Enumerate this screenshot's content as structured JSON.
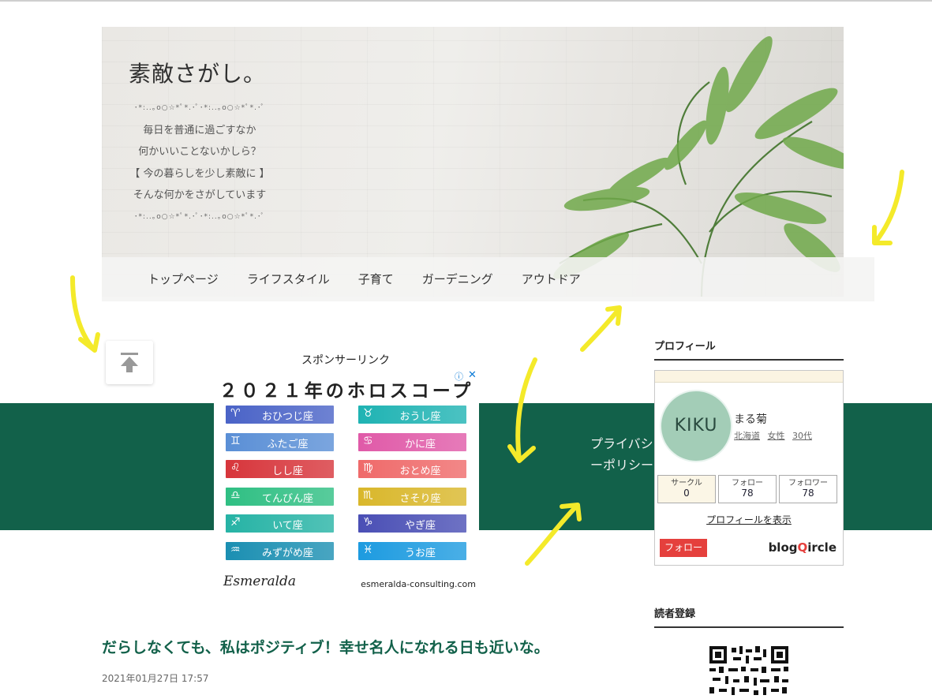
{
  "header": {
    "site_title": "素敵さがし。",
    "tagline_dots_top": "･*:..｡o○☆*ﾟ*.･ﾟ･*:..｡o○☆*ﾟ*.･ﾟ",
    "tagline_lines": [
      "毎日を普通に過ごすなか",
      "何かいいことないかしら？",
      "【 今の暮らしを少し素敵に 】",
      "そんな何かをさがしています"
    ],
    "tagline_dots_bottom": "･*:..｡o○☆*ﾟ*.･ﾟ･*:..｡o○☆*ﾟ*.･ﾟ"
  },
  "nav": {
    "items": [
      "トップページ",
      "ライフスタイル",
      "子育て",
      "ガーデニング",
      "アウトドア"
    ]
  },
  "sponsor": {
    "label": "スポンサーリンク",
    "ad_title": "２０２１年のホロスコープ",
    "info_icon": "info-icon",
    "close_icon": "close-icon",
    "signs_left": [
      {
        "symbol": "♈",
        "name": "おひつじ座",
        "color": "#4a63c7"
      },
      {
        "symbol": "♊",
        "name": "ふたご座",
        "color": "#5a8fd6"
      },
      {
        "symbol": "♌",
        "name": "しし座",
        "color": "#d7353b"
      },
      {
        "symbol": "♎",
        "name": "てんびん座",
        "color": "#2fbf83"
      },
      {
        "symbol": "♐",
        "name": "いて座",
        "color": "#26b3a5"
      },
      {
        "symbol": "♒",
        "name": "みずがめ座",
        "color": "#1b8fb2"
      }
    ],
    "signs_right": [
      {
        "symbol": "♉",
        "name": "おうし座",
        "color": "#1fb3b3"
      },
      {
        "symbol": "♋",
        "name": "かに座",
        "color": "#e05aa8"
      },
      {
        "symbol": "♍",
        "name": "おとめ座",
        "color": "#ef6a6a"
      },
      {
        "symbol": "♏",
        "name": "さそり座",
        "color": "#d9b72b"
      },
      {
        "symbol": "♑",
        "name": "やぎ座",
        "color": "#4a4fb5"
      },
      {
        "symbol": "♓",
        "name": "うお座",
        "color": "#1d9be0"
      }
    ],
    "brand": "Esmeralda",
    "url": "esmeralda-consulting.com"
  },
  "privacy_link": "プライバシーポリシー",
  "post": {
    "title": "だらしなくても、私はポジティブ！幸せ名人になれる日も近いな。",
    "date": "2021年01月27日 17:57"
  },
  "sidebar": {
    "profile_heading": "プロフィール",
    "avatar_text": "KIKU",
    "name": "まる菊",
    "meta": [
      "北海道",
      "女性",
      "30代"
    ],
    "stats": [
      {
        "label": "サークル",
        "value": "0"
      },
      {
        "label": "フォロー",
        "value": "78"
      },
      {
        "label": "フォロワー",
        "value": "78"
      }
    ],
    "profile_link": "プロフィールを表示",
    "follow_button": "フォロー",
    "blogcircle_logo": "blogcircle",
    "reader_heading": "読者登録"
  },
  "colors": {
    "accent_green": "#12614a",
    "follow_red": "#e5403d",
    "annotation_yellow": "#f4ea2a"
  }
}
